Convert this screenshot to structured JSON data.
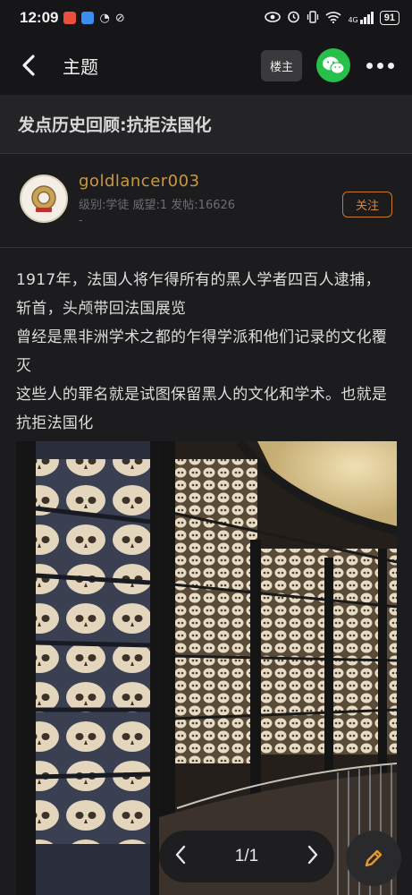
{
  "status_bar": {
    "time": "12:09",
    "battery": "91",
    "network": "4G"
  },
  "nav": {
    "title": "主题",
    "louzhu_label": "楼主"
  },
  "post": {
    "title": "发点历史回顾:抗拒法国化",
    "author": {
      "name": "goldlancer003",
      "meta": "级别:学徒 威望:1 发帖:16626",
      "extra": "-"
    },
    "follow_label": "关注",
    "paragraphs": [
      "1917年，法国人将乍得所有的黑人学者四百人逮捕，斩首，头颅带回法国展览",
      "曾经是黑非洲学术之都的乍得学派和他们记录的文化覆灭",
      "这些人的罪名就是试图保留黑人的文化和学术。也就是抗拒法国化"
    ]
  },
  "pager": {
    "text": "1/1"
  },
  "colors": {
    "accent_orange": "#d88a3c",
    "author_gold": "#c89a40",
    "wechat_green": "#27c04a"
  }
}
